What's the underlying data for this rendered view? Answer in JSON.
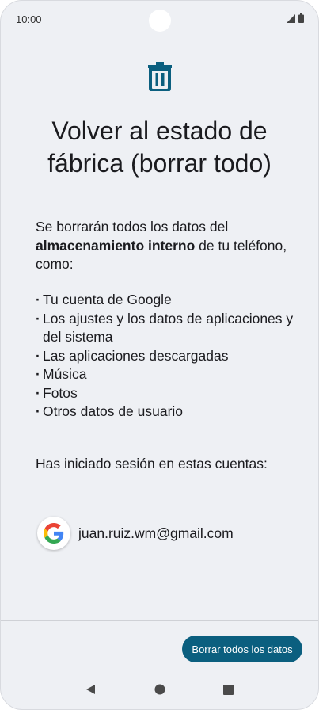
{
  "status_bar": {
    "time": "10:00"
  },
  "colors": {
    "accent": "#0b5f7f",
    "background": "#eef0f4"
  },
  "header": {
    "icon": "trash-icon",
    "title": "Volver al estado de fábrica (borrar todo)"
  },
  "intro": {
    "prefix": "Se borrarán todos los datos del ",
    "bold": "almacenamiento interno",
    "suffix": " de tu teléfono, como:"
  },
  "items": [
    "Tu cuenta de Google",
    "Los ajustes y los datos de aplicaciones y del sistema",
    "Las aplicaciones descargadas",
    "Música",
    "Fotos",
    "Otros datos de usuario"
  ],
  "accounts": {
    "label": "Has iniciado sesión en estas cuentas:",
    "list": [
      {
        "icon": "google-icon",
        "email": "juan.ruiz.wm@gmail.com"
      }
    ]
  },
  "actions": {
    "primary_label": "Borrar todos los datos"
  },
  "nav": {
    "back": "back-icon",
    "home": "home-icon",
    "recents": "recents-icon"
  }
}
